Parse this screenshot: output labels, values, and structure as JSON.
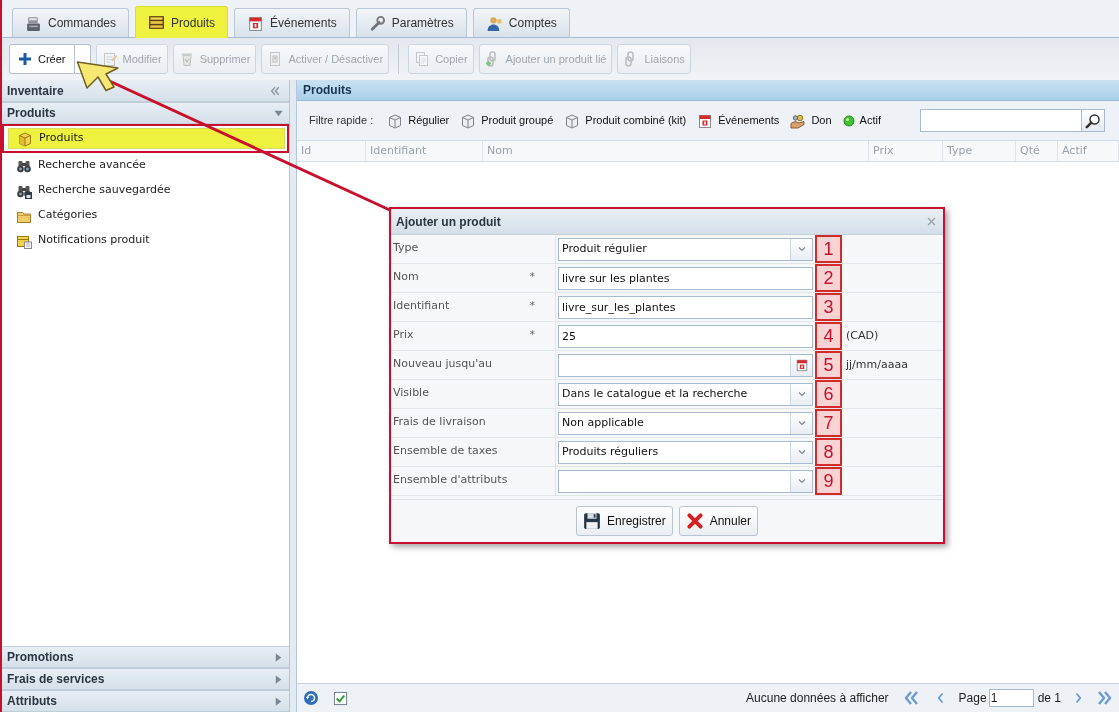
{
  "tabs": [
    {
      "label": "Commandes",
      "selected": false,
      "highlighted": false
    },
    {
      "label": "Produits",
      "selected": true,
      "highlighted": true
    },
    {
      "label": "Événements",
      "selected": false,
      "highlighted": false
    },
    {
      "label": "Paramètres",
      "selected": false,
      "highlighted": false
    },
    {
      "label": "Comptes",
      "selected": false,
      "highlighted": false
    }
  ],
  "toolbar": {
    "groups": [
      [
        {
          "label": "Créer",
          "disabled": false,
          "split": true
        },
        {
          "label": "Modifier",
          "disabled": true,
          "split": false
        },
        {
          "label": "Supprimer",
          "disabled": true,
          "split": false
        },
        {
          "label": "Activer / Désactiver",
          "disabled": true,
          "split": false
        }
      ],
      [
        {
          "label": "Copier",
          "disabled": true,
          "split": false
        },
        {
          "label": "Ajouter un produit lié",
          "disabled": true,
          "split": false
        },
        {
          "label": "Liaisons",
          "disabled": true,
          "split": false
        }
      ]
    ]
  },
  "sidebar": {
    "title": "Inventaire",
    "sections": [
      {
        "title": "Produits",
        "expanded": true,
        "items": [
          {
            "label": "Produits",
            "highlighted": true
          },
          {
            "label": "Recherche avancée",
            "highlighted": false
          },
          {
            "label": "Recherche sauvegardée",
            "highlighted": false
          },
          {
            "label": "Catégories",
            "highlighted": false
          },
          {
            "label": "Notifications produit",
            "highlighted": false
          }
        ]
      },
      {
        "title": "Promotions",
        "expanded": false
      },
      {
        "title": "Frais de services",
        "expanded": false
      },
      {
        "title": "Attributs",
        "expanded": false
      }
    ]
  },
  "main": {
    "title": "Produits",
    "quick_filter": {
      "label": "Filtre rapide :",
      "items": [
        "Régulier",
        "Produit groupé",
        "Produit combiné (kit)",
        "Événements",
        "Don",
        "Actif"
      ]
    },
    "columns": [
      "Id",
      "Identifiant",
      "Nom",
      "Prix",
      "Type",
      "Qté",
      "Actif"
    ],
    "pager": {
      "message": "Aucune données à afficher",
      "page_label": "Page",
      "page": "1",
      "total": "de 1"
    }
  },
  "dialog": {
    "title": "Ajouter un produit",
    "fields": [
      {
        "label": "Type",
        "kind": "select",
        "value": "Produit régulier",
        "badge": "1"
      },
      {
        "label": "Nom",
        "required_mark": "*",
        "kind": "text",
        "value": "livre sur les plantes",
        "badge": "2"
      },
      {
        "label": "Identifiant",
        "required_mark": "*",
        "kind": "text",
        "value": "livre_sur_les_plantes",
        "badge": "3"
      },
      {
        "label": "Prix",
        "required_mark": "*",
        "kind": "text",
        "value": "25",
        "badge": "4",
        "suffix": "(CAD)"
      },
      {
        "label": "Nouveau jusqu'au",
        "kind": "date",
        "badge": "5",
        "suffix": "jj/mm/aaaa"
      },
      {
        "label": "Visible",
        "kind": "select",
        "value": "Dans le catalogue et la recherche",
        "badge": "6"
      },
      {
        "label": "Frais de livraison",
        "kind": "select",
        "value": "Non applicable",
        "badge": "7"
      },
      {
        "label": "Ensemble de taxes",
        "kind": "select",
        "value": "Produits réguliers",
        "badge": "8"
      },
      {
        "label": "Ensemble d'attributs",
        "kind": "select",
        "badge": "9"
      }
    ],
    "buttons": [
      "Enregistrer",
      "Annuler"
    ]
  }
}
